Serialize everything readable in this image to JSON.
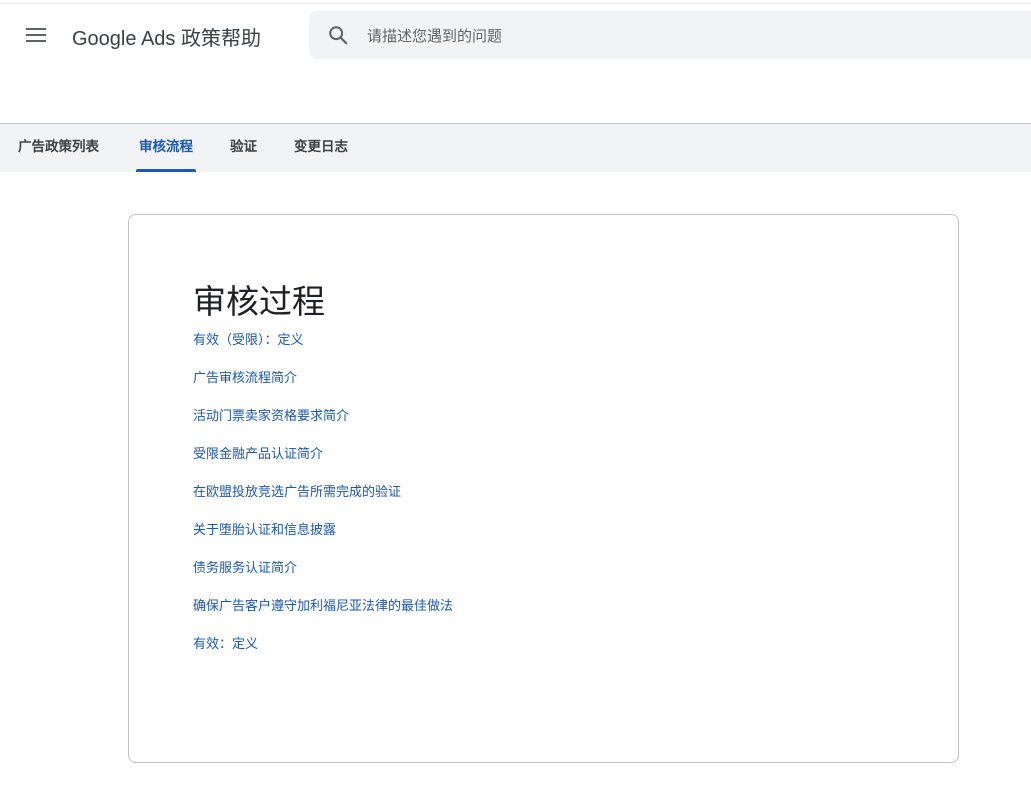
{
  "header": {
    "menu_icon": "menu-icon",
    "brand": "Google Ads 政策帮助",
    "search": {
      "icon": "search-icon",
      "placeholder": "请描述您遇到的问题",
      "value": ""
    }
  },
  "tabs": [
    {
      "label": "广告政策列表",
      "active": false
    },
    {
      "label": "审核流程",
      "active": true
    },
    {
      "label": "验证",
      "active": false
    },
    {
      "label": "变更日志",
      "active": false
    }
  ],
  "main": {
    "title": "审核过程",
    "links": [
      "有效（受限）：定义",
      "广告审核流程简介",
      "活动门票卖家资格要求简介",
      "受限金融产品认证简介",
      "在欧盟投放竞选广告所需完成的验证",
      "关于堕胎认证和信息披露",
      "债务服务认证简介",
      "确保广告客户遵守加利福尼亚法律的最佳做法",
      "有效：定义"
    ]
  },
  "colors": {
    "accent": "#1a57b6",
    "tabbar_bg": "#f1f3f4",
    "search_bg": "#f1f3f4",
    "text": "#202124"
  }
}
